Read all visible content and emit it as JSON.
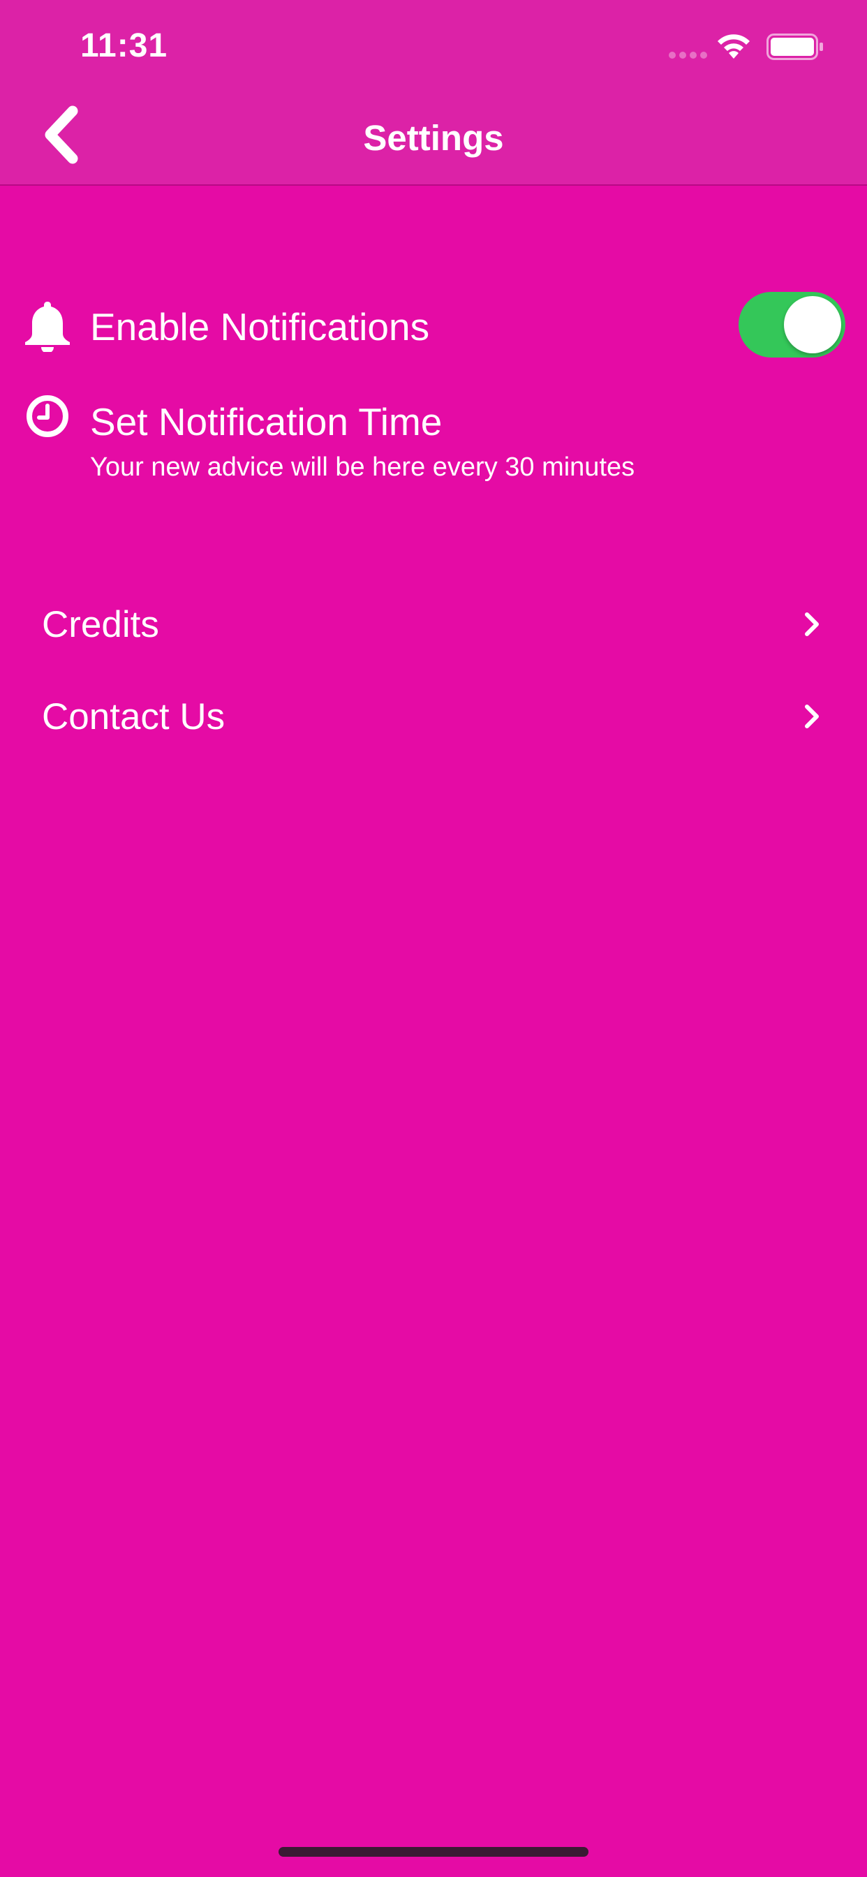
{
  "status_bar": {
    "time": "11:31"
  },
  "header": {
    "title": "Settings",
    "back_icon": "chevron-left-icon"
  },
  "settings": {
    "notifications": {
      "icon": "bell-icon",
      "label": "Enable Notifications",
      "enabled": true
    },
    "notification_time": {
      "icon": "clock-icon",
      "label": "Set Notification Time",
      "description": "Your new advice will be here every 30 minutes"
    }
  },
  "links": [
    {
      "label": "Credits",
      "icon": "chevron-right-icon"
    },
    {
      "label": "Contact Us",
      "icon": "chevron-right-icon"
    }
  ],
  "colors": {
    "background": "#E50BA5",
    "header": "#DC22A7",
    "toggle_on": "#34C759",
    "text": "#FFFFFF"
  }
}
